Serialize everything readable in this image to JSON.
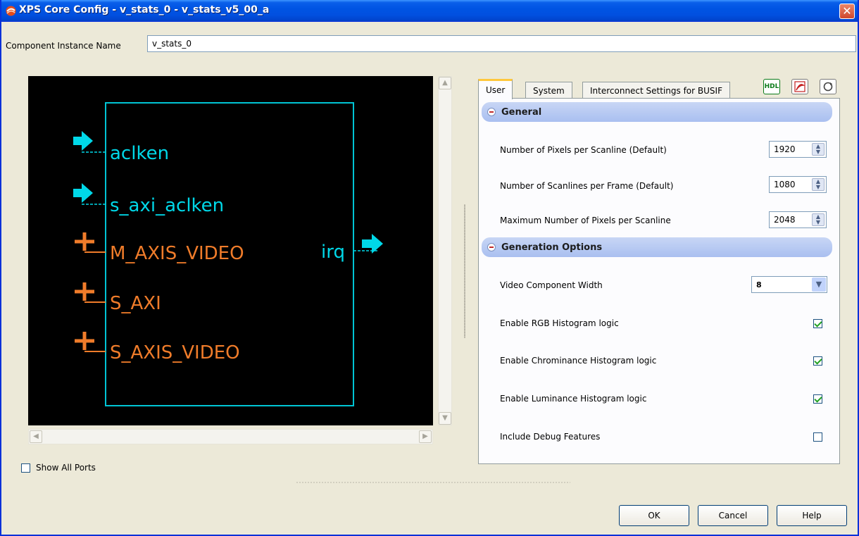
{
  "window": {
    "title": "XPS Core Config - v_stats_0 - v_stats_v5_00_a",
    "close_icon": "close-icon"
  },
  "instance": {
    "label": "Component Instance Name",
    "value": "v_stats_0"
  },
  "symbol": {
    "inputs": [
      {
        "name": "aclken",
        "kind": "arrow"
      },
      {
        "name": "s_axi_aclken",
        "kind": "arrow"
      },
      {
        "name": "M_AXIS_VIDEO",
        "kind": "bus"
      },
      {
        "name": "S_AXI",
        "kind": "bus"
      },
      {
        "name": "S_AXIS_VIDEO",
        "kind": "bus"
      }
    ],
    "outputs": [
      {
        "name": "irq",
        "kind": "arrow"
      }
    ],
    "colors": {
      "background": "#000000",
      "box": "#00c4d4",
      "signal": "#00d8e8",
      "bus": "#f07c2a"
    }
  },
  "show_all_ports": {
    "label": "Show All Ports",
    "checked": false
  },
  "tabs": [
    {
      "label": "User",
      "active": true
    },
    {
      "label": "System",
      "active": false
    },
    {
      "label": "Interconnect Settings for BUSIF",
      "active": false
    }
  ],
  "header_icons": [
    {
      "name": "hdl-icon",
      "text": "HDL"
    },
    {
      "name": "pdf-icon",
      "text": "PDF"
    },
    {
      "name": "refresh-icon",
      "text": ""
    }
  ],
  "sections": {
    "general": {
      "title": "General",
      "params": [
        {
          "label": "Number of Pixels per Scanline (Default)",
          "value": "1920"
        },
        {
          "label": "Number of Scanlines per Frame (Default)",
          "value": "1080"
        },
        {
          "label": "Maximum Number of Pixels per Scanline",
          "value": "2048"
        }
      ]
    },
    "generation": {
      "title": "Generation Options",
      "select": {
        "label": "Video Component Width",
        "value": "8"
      },
      "checks": [
        {
          "label": "Enable RGB Histogram logic",
          "checked": true
        },
        {
          "label": "Enable Chrominance Histogram logic",
          "checked": true
        },
        {
          "label": "Enable Luminance Histogram logic",
          "checked": true
        },
        {
          "label": "Include Debug Features",
          "checked": false
        }
      ]
    }
  },
  "buttons": {
    "ok": "OK",
    "cancel": "Cancel",
    "help": "Help"
  }
}
